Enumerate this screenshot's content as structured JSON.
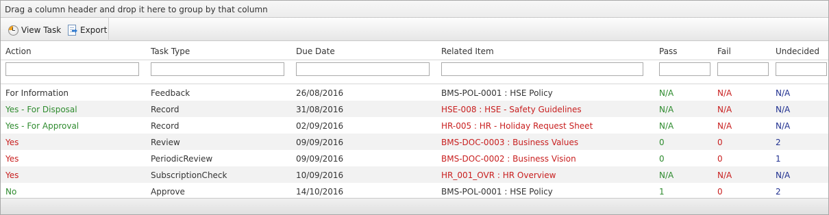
{
  "group_panel": {
    "text": "Drag a column header and drop it here to group by that column"
  },
  "toolbar": {
    "view_task_label": "View Task",
    "export_label": "Export"
  },
  "columns": [
    "Action",
    "Task Type",
    "Due Date",
    "Related Item",
    "Pass",
    "Fail",
    "Undecided"
  ],
  "colors": {
    "green": "#2e8b2e",
    "red": "#c81e1e",
    "blue": "#1f2f8f",
    "default": "#333333"
  },
  "rows": [
    {
      "action": "For Information",
      "action_color": "default",
      "task_type": "Feedback",
      "due_date": "26/08/2016",
      "related_item": "BMS-POL-0001 : HSE Policy",
      "related_color": "default",
      "pass": "N/A",
      "fail": "N/A",
      "undecided": "N/A"
    },
    {
      "action": "Yes - For Disposal",
      "action_color": "green",
      "task_type": "Record",
      "due_date": "31/08/2016",
      "related_item": "HSE-008 : HSE - Safety Guidelines",
      "related_color": "red",
      "pass": "N/A",
      "fail": "N/A",
      "undecided": "N/A"
    },
    {
      "action": "Yes - For Approval",
      "action_color": "green",
      "task_type": "Record",
      "due_date": "02/09/2016",
      "related_item": "HR-005 : HR - Holiday Request Sheet",
      "related_color": "red",
      "pass": "N/A",
      "fail": "N/A",
      "undecided": "N/A"
    },
    {
      "action": "Yes",
      "action_color": "red",
      "task_type": "Review",
      "due_date": "09/09/2016",
      "related_item": "BMS-DOC-0003 : Business Values",
      "related_color": "red",
      "pass": "0",
      "fail": "0",
      "undecided": "2"
    },
    {
      "action": "Yes",
      "action_color": "red",
      "task_type": "PeriodicReview",
      "due_date": "09/09/2016",
      "related_item": "BMS-DOC-0002 : Business Vision",
      "related_color": "red",
      "pass": "0",
      "fail": "0",
      "undecided": "1"
    },
    {
      "action": "Yes",
      "action_color": "red",
      "task_type": "SubscriptionCheck",
      "due_date": "10/09/2016",
      "related_item": "HR_001_OVR : HR Overview",
      "related_color": "red",
      "pass": "N/A",
      "fail": "N/A",
      "undecided": "N/A"
    },
    {
      "action": "No",
      "action_color": "green",
      "task_type": "Approve",
      "due_date": "14/10/2016",
      "related_item": "BMS-POL-0001 : HSE Policy",
      "related_color": "default",
      "pass": "1",
      "fail": "0",
      "undecided": "2"
    }
  ]
}
